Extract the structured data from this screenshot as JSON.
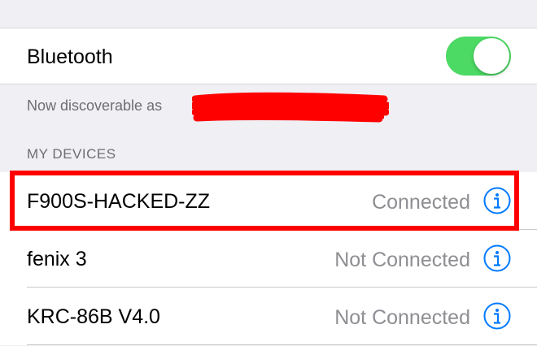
{
  "bluetooth": {
    "label": "Bluetooth",
    "enabled": true,
    "toggle_color": "#4cd964"
  },
  "discoverable_text": "Now discoverable as",
  "section_header": "MY DEVICES",
  "devices": [
    {
      "name": "F900S-HACKED-ZZ",
      "status": "Connected",
      "icon": "info-icon",
      "highlighted": true
    },
    {
      "name": "fenix 3",
      "status": "Not Connected",
      "icon": "info-icon"
    },
    {
      "name": "KRC-86B V4.0",
      "status": "Not Connected",
      "icon": "info-icon"
    }
  ],
  "colors": {
    "accent": "#007aff",
    "highlight": "#ff0000",
    "redaction": "#ff0000",
    "background": "#efeff4"
  }
}
